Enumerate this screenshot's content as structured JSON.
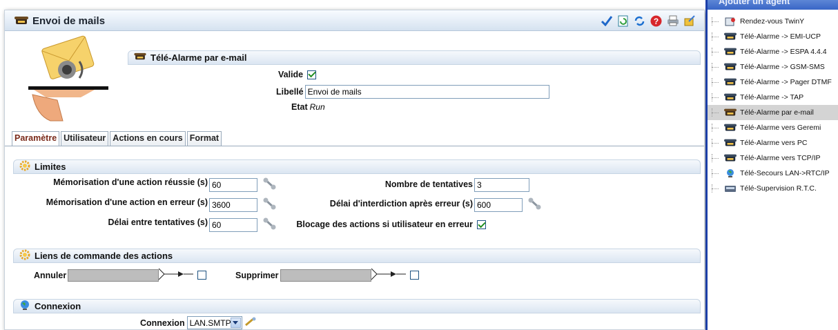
{
  "window": {
    "title": "Envoi de mails"
  },
  "toolbar": {
    "icons": [
      "check-icon",
      "refresh-doc-icon",
      "sync-icon",
      "help-icon",
      "print-icon",
      "export-icon"
    ]
  },
  "info": {
    "section_title": "Télé-Alarme par e-mail",
    "valide_label": "Valide",
    "libelle_label": "Libellé",
    "libelle_value": "Envoi de mails",
    "etat_label": "Etat",
    "etat_value": "Run"
  },
  "tabs": [
    "Paramètre",
    "Utilisateur",
    "Actions en cours",
    "Format"
  ],
  "limites": {
    "title": "Limites",
    "mem_reussie_label": "Mémorisation d'une action réussie (s)",
    "mem_reussie_value": "60",
    "mem_erreur_label": "Mémorisation d'une action en erreur (s)",
    "mem_erreur_value": "3600",
    "delai_tentatives_label": "Délai entre tentatives (s)",
    "delai_tentatives_value": "60",
    "nb_tentatives_label": "Nombre de tentatives",
    "nb_tentatives_value": "3",
    "delai_interdiction_label": "Délai d'interdiction après erreur (s)",
    "delai_interdiction_value": "600",
    "blocage_label": "Blocage des actions si utilisateur en erreur"
  },
  "liens": {
    "title": "Liens de commande des actions",
    "annuler_label": "Annuler",
    "supprimer_label": "Supprimer"
  },
  "connexion": {
    "title": "Connexion",
    "label": "Connexion",
    "value": "LAN.SMTP"
  },
  "agent_panel": {
    "title": "Ajouter un agent",
    "items": [
      {
        "label": "Rendez-vous TwinY",
        "icon": "rendezvous-icon"
      },
      {
        "label": "Télé-Alarme -> EMI-UCP",
        "icon": "phone-icon"
      },
      {
        "label": "Télé-Alarme -> ESPA 4.4.4",
        "icon": "phone-icon"
      },
      {
        "label": "Télé-Alarme -> GSM-SMS",
        "icon": "phone-icon"
      },
      {
        "label": "Télé-Alarme -> Pager DTMF",
        "icon": "phone-icon"
      },
      {
        "label": "Télé-Alarme -> TAP",
        "icon": "phone-icon"
      },
      {
        "label": "Télé-Alarme par e-mail",
        "icon": "mail-phone-icon",
        "selected": true
      },
      {
        "label": "Télé-Alarme vers Geremi",
        "icon": "phone-icon"
      },
      {
        "label": "Télé-Alarme vers PC",
        "icon": "phone-icon"
      },
      {
        "label": "Télé-Alarme vers TCP/IP",
        "icon": "phone-icon"
      },
      {
        "label": "Télé-Secours LAN->RTC/IP",
        "icon": "globe-icon"
      },
      {
        "label": "Télé-Supervision R.T.C.",
        "icon": "device-icon"
      }
    ]
  }
}
